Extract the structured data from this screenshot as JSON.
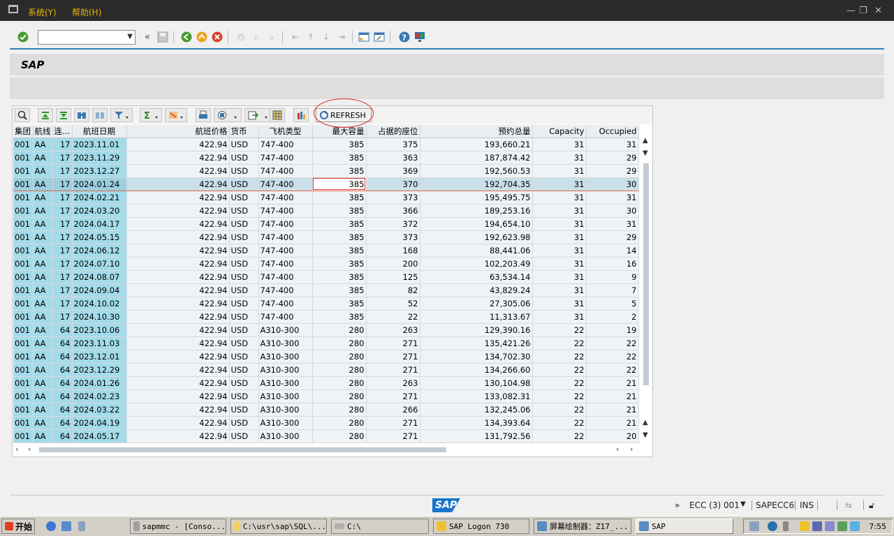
{
  "menu": {
    "items": [
      "系统(Y)",
      "帮助(H)"
    ]
  },
  "toolbar": {
    "command_field_value": "",
    "icons": [
      "enter-icon",
      "save-icon",
      "back-icon",
      "exit-icon",
      "cancel-icon",
      "print-icon",
      "find-icon",
      "find-next-icon",
      "first-page-icon",
      "prev-page-icon",
      "next-page-icon",
      "last-page-icon",
      "new-session-icon",
      "shortcut-icon",
      "help-icon",
      "layout-icon"
    ]
  },
  "title": {
    "text": "SAP"
  },
  "alv": {
    "refresh_label": "REFRESH",
    "columns": [
      "集团",
      "航线",
      "连...",
      "航班日期",
      "航班价格",
      "货币",
      "飞机类型",
      "最大容量",
      "占据的座位",
      "预约总量",
      "Capacity",
      "Occupied"
    ],
    "rows": [
      [
        "001",
        "AA",
        "17",
        "2023.11.01",
        "422.94",
        "USD",
        "747-400",
        "385",
        "375",
        "193,660.21",
        "31",
        "31"
      ],
      [
        "001",
        "AA",
        "17",
        "2023.11.29",
        "422.94",
        "USD",
        "747-400",
        "385",
        "363",
        "187,874.42",
        "31",
        "29"
      ],
      [
        "001",
        "AA",
        "17",
        "2023.12.27",
        "422.94",
        "USD",
        "747-400",
        "385",
        "369",
        "192,560.53",
        "31",
        "29"
      ],
      [
        "001",
        "AA",
        "17",
        "2024.01.24",
        "422.94",
        "USD",
        "747-400",
        "385",
        "370",
        "192,704.35",
        "31",
        "30"
      ],
      [
        "001",
        "AA",
        "17",
        "2024.02.21",
        "422.94",
        "USD",
        "747-400",
        "385",
        "373",
        "195,495.75",
        "31",
        "31"
      ],
      [
        "001",
        "AA",
        "17",
        "2024.03.20",
        "422.94",
        "USD",
        "747-400",
        "385",
        "366",
        "189,253.16",
        "31",
        "30"
      ],
      [
        "001",
        "AA",
        "17",
        "2024.04.17",
        "422.94",
        "USD",
        "747-400",
        "385",
        "372",
        "194,654.10",
        "31",
        "31"
      ],
      [
        "001",
        "AA",
        "17",
        "2024.05.15",
        "422.94",
        "USD",
        "747-400",
        "385",
        "373",
        "192,623.98",
        "31",
        "29"
      ],
      [
        "001",
        "AA",
        "17",
        "2024.06.12",
        "422.94",
        "USD",
        "747-400",
        "385",
        "168",
        "88,441.06",
        "31",
        "14"
      ],
      [
        "001",
        "AA",
        "17",
        "2024.07.10",
        "422.94",
        "USD",
        "747-400",
        "385",
        "200",
        "102,203.49",
        "31",
        "16"
      ],
      [
        "001",
        "AA",
        "17",
        "2024.08.07",
        "422.94",
        "USD",
        "747-400",
        "385",
        "125",
        "63,534.14",
        "31",
        "9"
      ],
      [
        "001",
        "AA",
        "17",
        "2024.09.04",
        "422.94",
        "USD",
        "747-400",
        "385",
        "82",
        "43,829.24",
        "31",
        "7"
      ],
      [
        "001",
        "AA",
        "17",
        "2024.10.02",
        "422.94",
        "USD",
        "747-400",
        "385",
        "52",
        "27,305.06",
        "31",
        "5"
      ],
      [
        "001",
        "AA",
        "17",
        "2024.10.30",
        "422.94",
        "USD",
        "747-400",
        "385",
        "22",
        "11,313.67",
        "31",
        "2"
      ],
      [
        "001",
        "AA",
        "64",
        "2023.10.06",
        "422.94",
        "USD",
        "A310-300",
        "280",
        "263",
        "129,390.16",
        "22",
        "19"
      ],
      [
        "001",
        "AA",
        "64",
        "2023.11.03",
        "422.94",
        "USD",
        "A310-300",
        "280",
        "271",
        "135,421.26",
        "22",
        "22"
      ],
      [
        "001",
        "AA",
        "64",
        "2023.12.01",
        "422.94",
        "USD",
        "A310-300",
        "280",
        "271",
        "134,702.30",
        "22",
        "22"
      ],
      [
        "001",
        "AA",
        "64",
        "2023.12.29",
        "422.94",
        "USD",
        "A310-300",
        "280",
        "271",
        "134,266.60",
        "22",
        "22"
      ],
      [
        "001",
        "AA",
        "64",
        "2024.01.26",
        "422.94",
        "USD",
        "A310-300",
        "280",
        "263",
        "130,104.98",
        "22",
        "21"
      ],
      [
        "001",
        "AA",
        "64",
        "2024.02.23",
        "422.94",
        "USD",
        "A310-300",
        "280",
        "271",
        "133,082.31",
        "22",
        "21"
      ],
      [
        "001",
        "AA",
        "64",
        "2024.03.22",
        "422.94",
        "USD",
        "A310-300",
        "280",
        "266",
        "132,245.06",
        "22",
        "21"
      ],
      [
        "001",
        "AA",
        "64",
        "2024.04.19",
        "422.94",
        "USD",
        "A310-300",
        "280",
        "271",
        "134,393.64",
        "22",
        "21"
      ],
      [
        "001",
        "AA",
        "64",
        "2024.05.17",
        "422.94",
        "USD",
        "A310-300",
        "280",
        "271",
        "131,792.56",
        "22",
        "20"
      ]
    ],
    "selected_row_index": 3
  },
  "statusbar": {
    "system": "ECC (3) 001",
    "server": "SAPECC6",
    "mode": "INS"
  },
  "taskbar": {
    "start_label": "开始",
    "items": [
      "sapmmc - [Conso...",
      "C:\\usr\\sap\\SQL\\...",
      "C:\\",
      "SAP Logon 730",
      "屏幕绘制器：Z17_...",
      "SAP"
    ],
    "active_index": 5,
    "clock": "7:55"
  },
  "colors": {
    "key_column": "#a3dbea",
    "menu_text": "#e8b400",
    "accent_line": "#2a82b8",
    "highlight_circle": "#e02020"
  }
}
